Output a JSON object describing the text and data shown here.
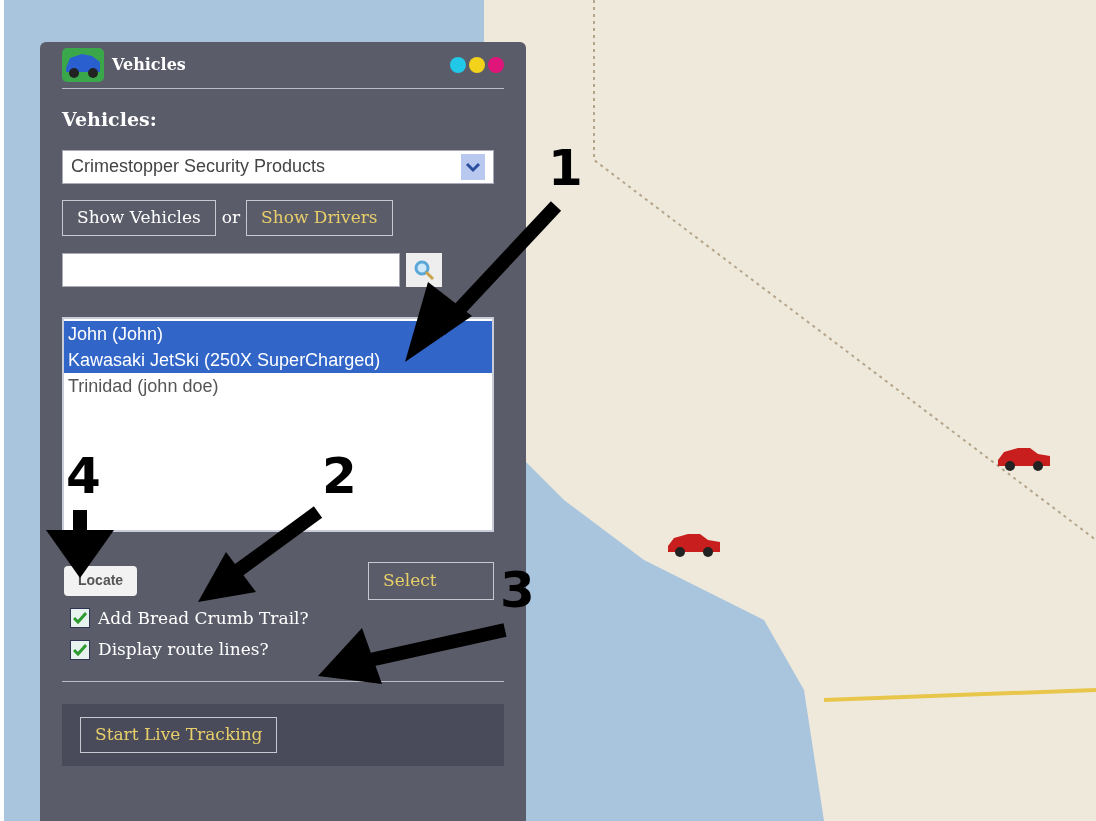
{
  "panel": {
    "title": "Vehicles",
    "window_buttons": [
      {
        "color": "#22c8e8"
      },
      {
        "color": "#f2d21a"
      },
      {
        "color": "#e0157a"
      }
    ],
    "vehicles_label": "Vehicles:",
    "company_select": {
      "value": "Crimestopper Security Products"
    },
    "show_vehicles_button": "Show Vehicles",
    "or_text": "or",
    "show_drivers_button": "Show Drivers",
    "vehicle_list": [
      {
        "label": "John (John)",
        "selected": true
      },
      {
        "label": "Kawasaki JetSki (250X SuperCharged)",
        "selected": true
      },
      {
        "label": "Trinidad (john doe)",
        "selected": false
      }
    ],
    "locate_button": "Locate",
    "select_button": "Select",
    "options": [
      {
        "label": "Add Bread Crumb Trail?",
        "checked": true
      },
      {
        "label": "Display route lines?",
        "checked": true
      }
    ],
    "live_tracking_button": "Start Live Tracking"
  },
  "annotations": [
    {
      "label": "1"
    },
    {
      "label": "2"
    },
    {
      "label": "3"
    },
    {
      "label": "4"
    }
  ]
}
